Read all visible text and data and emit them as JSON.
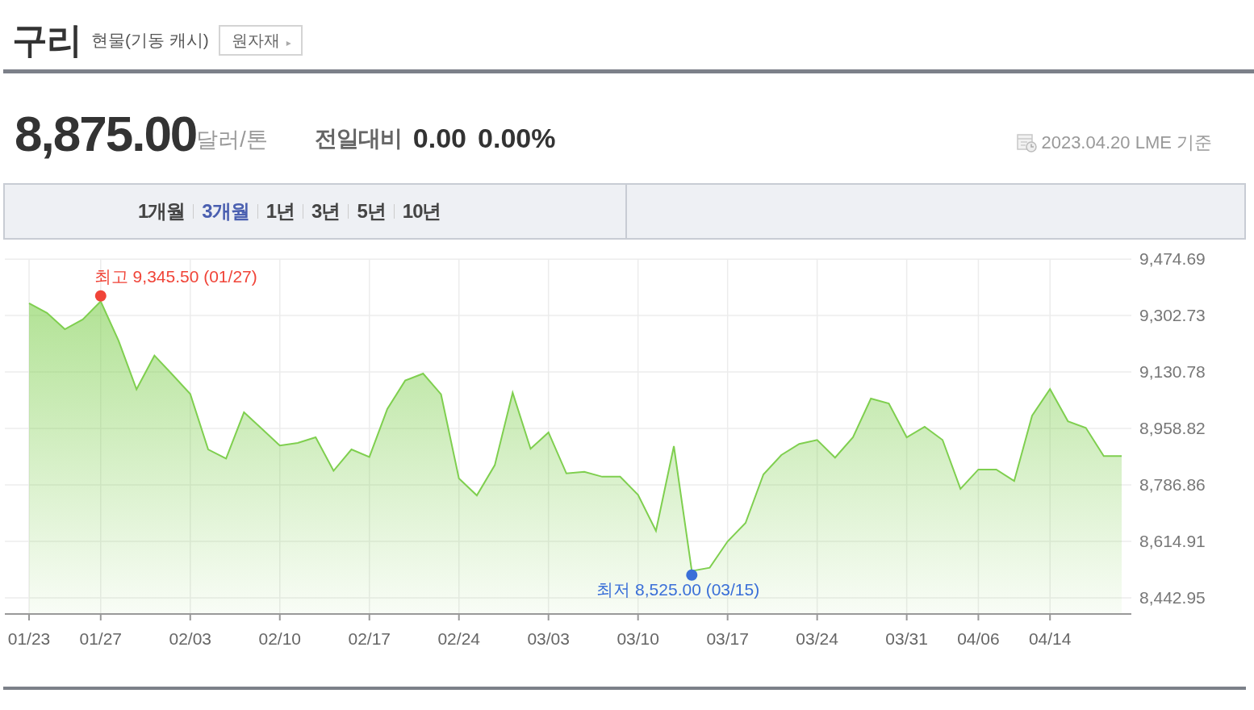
{
  "header": {
    "title": "구리",
    "subtitle": "현물(기동 캐시)",
    "category_button": "원자재",
    "category_arrow": "▸"
  },
  "quote": {
    "price": "8,875.00",
    "unit": "달러/톤",
    "change_label": "전일대비",
    "change": "0.00",
    "change_percent": "0.00%",
    "as_of": "2023.04.20 LME 기준"
  },
  "periods": [
    {
      "label": "1개월",
      "selected": false
    },
    {
      "label": "3개월",
      "selected": true
    },
    {
      "label": "1년",
      "selected": false
    },
    {
      "label": "3년",
      "selected": false
    },
    {
      "label": "5년",
      "selected": false
    },
    {
      "label": "10년",
      "selected": false
    }
  ],
  "chart": {
    "chart_data": {
      "type": "area",
      "categories": [
        "01/23",
        null,
        null,
        null,
        "01/27",
        null,
        null,
        null,
        null,
        "02/03",
        null,
        null,
        null,
        null,
        "02/10",
        null,
        null,
        null,
        null,
        "02/17",
        null,
        null,
        null,
        null,
        "02/24",
        null,
        null,
        null,
        null,
        "03/03",
        null,
        null,
        null,
        null,
        "03/10",
        null,
        null,
        null,
        null,
        "03/17",
        null,
        null,
        null,
        null,
        "03/24",
        null,
        null,
        null,
        null,
        "03/31",
        null,
        null,
        null,
        "04/06",
        null,
        null,
        null,
        "04/14",
        null,
        null,
        null,
        null
      ],
      "series": [
        {
          "color": "#7fcf4f",
          "values": [
            9340,
            9311,
            9261,
            9291,
            9346,
            9226,
            9078,
            9181,
            9123,
            9064,
            8895,
            8867,
            9008,
            8958,
            8907,
            8915,
            8932,
            8830,
            8895,
            8872,
            9018,
            9105,
            9126,
            9063,
            8807,
            8755,
            8847,
            9068,
            8897,
            8947,
            8822,
            8827,
            8812,
            8812,
            8757,
            8647,
            8905,
            8525,
            8535,
            8615,
            8671,
            8819,
            8878,
            8912,
            8924,
            8870,
            8932,
            9050,
            9035,
            8932,
            8964,
            8924,
            8775,
            8834,
            8834,
            8799,
            8998,
            9079,
            8981,
            8961,
            8875,
            8875
          ]
        }
      ],
      "ylim": [
        8394,
        9475
      ],
      "yticks": [
        {
          "value": 9474.69,
          "label": "9,474.69"
        },
        {
          "value": 9302.73,
          "label": "9,302.73"
        },
        {
          "value": 9130.78,
          "label": "9,130.78"
        },
        {
          "value": 8958.82,
          "label": "8,958.82"
        },
        {
          "value": 8786.86,
          "label": "8,786.86"
        },
        {
          "value": 8614.91,
          "label": "8,614.91"
        },
        {
          "value": 8442.95,
          "label": "8,442.95"
        }
      ],
      "grid": true,
      "annotations": [
        {
          "text": "최고 9,345.50 (01/27)",
          "x": "01/27",
          "y": 9345.5
        },
        "최저 8,525.00 (03/15)"
      ]
    }
  }
}
